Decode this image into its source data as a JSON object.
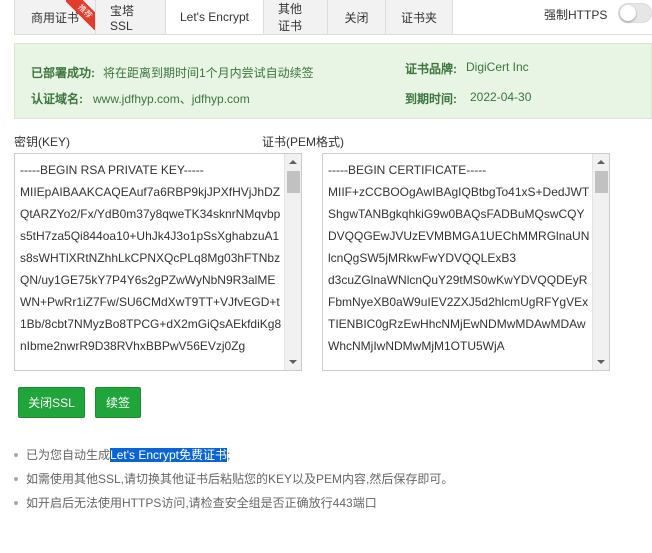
{
  "tabs": [
    {
      "label": "商用证书",
      "badge": "推荐"
    },
    {
      "label": "宝塔SSL"
    },
    {
      "label": "Let's Encrypt"
    },
    {
      "label": "其他证书"
    },
    {
      "label": "关闭"
    },
    {
      "label": "证书夹"
    }
  ],
  "active_tab": "Let's Encrypt",
  "force_https": {
    "label": "强制HTTPS",
    "enabled": false
  },
  "info": {
    "deployed_label": "已部署成功:",
    "deployed_value": "将在距离到期时间1个月内尝试自动续签",
    "brand_label": "证书品牌:",
    "brand_value": "DigiCert Inc",
    "domain_label": "认证域名:",
    "domain_value": "www.jdfhyp.com、jdfhyp.com",
    "expire_label": "到期时间:",
    "expire_value": "2022-04-30"
  },
  "key": {
    "label": "密钥(KEY)",
    "content": "-----BEGIN RSA PRIVATE KEY-----\nMIIEpAIBAAKCAQEAuf7a6RBP9kjJPXfHVjJhDZQtARZYo2/Fx/YdB0m37y8qweTK34sknrNMqvbps5tH7za5Qi844oa10+UhJk4J3o1pSsXghabzuA1s8sWHTlXRtNZhhLkCPNXQcPLq8Mg03hFTNbzQN/uy1GE75kY7P4Y6s2gPZwWyNbN9R3alMEWN+PwRr1iZ7Fw/SU6CMdXwT9TT+VJfvEGD+t1Bb/8cbt7NMyzBo8TPCG+dX2mGiQsAEkfdiKg8nIbme2nwrR9D38RVhxBBPwV56EVzj0Zg"
  },
  "cert": {
    "label": "证书(PEM格式)",
    "content": "-----BEGIN CERTIFICATE-----\nMIIF+zCCBOOgAwIBAgIQBtbgTo41xS+DedJWTShgwTANBgkqhkiG9w0BAQsFADBuMQswCQYDVQQGEwJVUzEVMBMGA1UEChMMRGlnaUNlcnQgSW5jMRkwFwYDVQQLExB3\nd3cuZGlnaWNlcnQuY29tMS0wKwYDVQQDEyRFbmNyeXB0aW9uIEV2ZXJ5d2hlcmUgRFYgVExTIENBIC0gRzEwHhcNMjEwNDMwMDAwMDAwWhcNMjIwNDMwMjM1OTU5WjA"
  },
  "buttons": {
    "close_ssl": "关闭SSL",
    "renew": "续签"
  },
  "tips": {
    "tip1_prefix": "已为您自动生成",
    "tip1_highlight": "Let's Encrypt免费证书",
    "tip1_suffix": ";",
    "tip2": "如需使用其他SSL,请切换其他证书后粘贴您的KEY以及PEM内容,然后保存即可。",
    "tip3": "如开启后无法使用HTTPS访问,请检查安全组是否正确放行443端口"
  },
  "colors": {
    "accent_green": "#20a53a",
    "info_bg": "#e8f5e4",
    "info_text": "#3c763d",
    "badge_red": "#e43b2d",
    "highlight_blue": "#0a64d6"
  }
}
